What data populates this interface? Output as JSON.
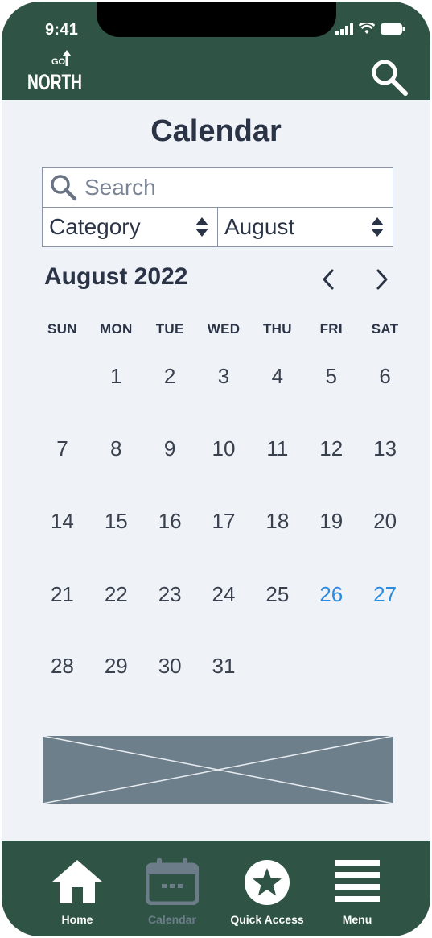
{
  "status_bar": {
    "time": "9:41"
  },
  "header": {
    "logo_text_top": "GO",
    "logo_text": "NORTH",
    "search_icon": "search-icon"
  },
  "page": {
    "title": "Calendar"
  },
  "filters": {
    "search_placeholder": "Search",
    "category_label": "Category",
    "month_label": "August"
  },
  "calendar": {
    "month_year": "August 2022",
    "weekdays": [
      "SUN",
      "MON",
      "TUE",
      "WED",
      "THU",
      "FRI",
      "SAT"
    ],
    "weeks": [
      [
        "",
        "1",
        "2",
        "3",
        "4",
        "5",
        "6"
      ],
      [
        "7",
        "8",
        "9",
        "10",
        "11",
        "12",
        "13"
      ],
      [
        "14",
        "15",
        "16",
        "17",
        "18",
        "19",
        "20"
      ],
      [
        "21",
        "22",
        "23",
        "24",
        "25",
        "26",
        "27"
      ],
      [
        "28",
        "29",
        "30",
        "31",
        "",
        "",
        ""
      ]
    ],
    "highlighted_days": [
      "26",
      "27"
    ],
    "highlight_color": "#2a8be0"
  },
  "tab_bar": {
    "tabs": [
      {
        "label": "Home",
        "icon": "home-icon"
      },
      {
        "label": "Calendar",
        "icon": "calendar-icon",
        "active": true
      },
      {
        "label": "Quick Access",
        "icon": "star-circle-icon"
      },
      {
        "label": "Menu",
        "icon": "menu-icon"
      }
    ]
  },
  "colors": {
    "brand": "#2f5445",
    "background": "#eff2f6",
    "text": "#2b3447",
    "placeholder_image": "#6e7f8c"
  }
}
